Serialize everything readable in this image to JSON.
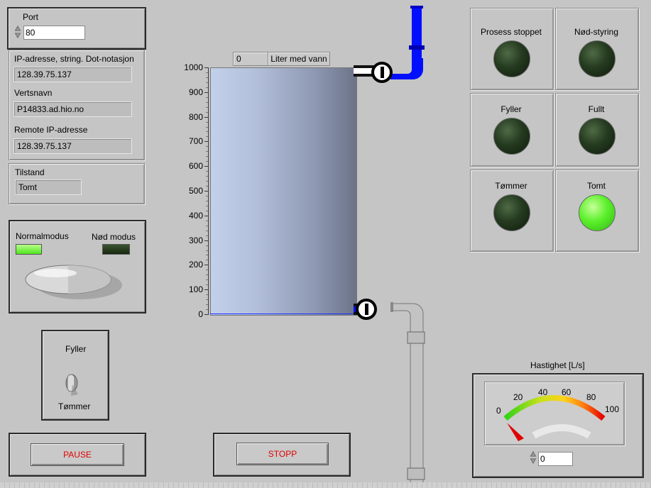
{
  "port": {
    "label": "Port",
    "value": "80"
  },
  "network": {
    "ip_label": "IP-adresse, string. Dot-notasjon",
    "ip_value": "128.39.75.137",
    "host_label": "Vertsnavn",
    "host_value": "P14833.ad.hio.no",
    "remote_label": "Remote IP-adresse",
    "remote_value": "128.39.75.137"
  },
  "state": {
    "label": "Tilstand",
    "value": "Tomt"
  },
  "mode": {
    "normal_label": "Normalmodus",
    "emergency_label": "Nød modus",
    "normal_on": true,
    "emergency_on": false
  },
  "fill_switch": {
    "top_label": "Fyller",
    "bottom_label": "Tømmer"
  },
  "buttons": {
    "pause": "PAUSE",
    "stop": "STOPP"
  },
  "tank": {
    "value": "0",
    "value_label": "Liter med vann",
    "fill_fraction": 0,
    "scale": [
      "1000",
      "900",
      "800",
      "700",
      "600",
      "500",
      "400",
      "300",
      "200",
      "100",
      "0"
    ]
  },
  "status_leds": [
    {
      "label": "Prosess stoppet",
      "on": false
    },
    {
      "label": "Nød-styring",
      "on": false
    },
    {
      "label": "Fyller",
      "on": false
    },
    {
      "label": "Fullt",
      "on": false
    },
    {
      "label": "Tømmer",
      "on": false
    },
    {
      "label": "Tomt",
      "on": true
    }
  ],
  "gauge": {
    "title": "Hastighet [L/s]",
    "ticks": [
      "0",
      "20",
      "40",
      "60",
      "80",
      "100"
    ],
    "value": 0,
    "input_value": "0"
  }
}
